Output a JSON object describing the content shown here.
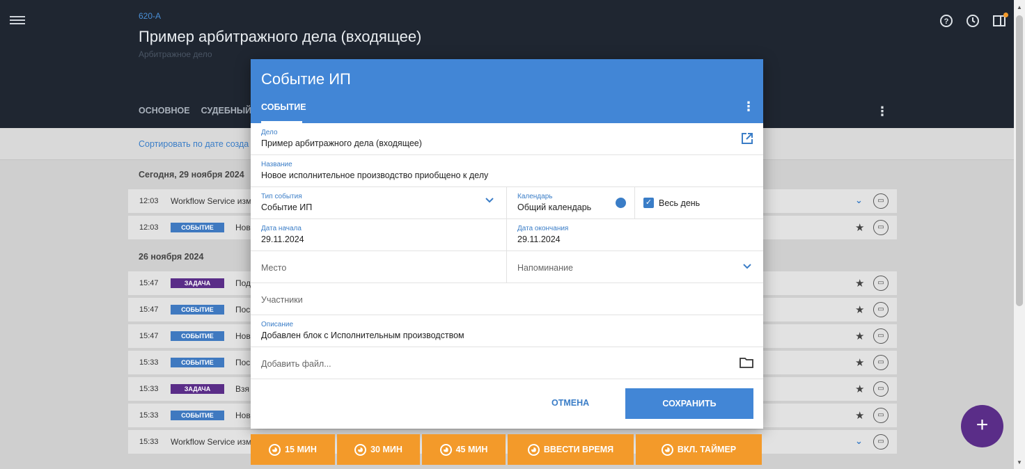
{
  "header": {
    "case_number": "620-А",
    "case_title": "Пример арбитражного дела (входящее)",
    "case_type": "Арбитражное дело",
    "tabs": [
      "ОСНОВНОЕ",
      "СУДЕБНЫЙ П"
    ]
  },
  "sort": {
    "label": "Сортировать по дате созда"
  },
  "list": {
    "groups": [
      {
        "date": "Сегодня, 29 ноября 2024",
        "rows": [
          {
            "time": "12:03",
            "badge": "",
            "text": "Workflow Service изм"
          },
          {
            "time": "12:03",
            "badge": "СОБЫТИЕ",
            "text": "Нов"
          }
        ]
      },
      {
        "date": "26 ноября 2024",
        "rows": [
          {
            "time": "15:47",
            "badge": "ЗАДАЧА",
            "text": "Под"
          },
          {
            "time": "15:47",
            "badge": "СОБЫТИЕ",
            "text": "Пос"
          },
          {
            "time": "15:47",
            "badge": "СОБЫТИЕ",
            "text": "Нов"
          },
          {
            "time": "15:33",
            "badge": "СОБЫТИЕ",
            "text": "Пос"
          },
          {
            "time": "15:33",
            "badge": "ЗАДАЧА",
            "text": "Взя"
          },
          {
            "time": "15:33",
            "badge": "СОБЫТИЕ",
            "text": "Нов"
          },
          {
            "time": "15:33",
            "badge": "",
            "text": "Workflow Service изм"
          }
        ]
      }
    ]
  },
  "dialog": {
    "title": "Событие ИП",
    "tab": "СОБЫТИЕ",
    "case_label": "Дело",
    "case_value": "Пример арбитражного дела (входящее)",
    "name_label": "Название",
    "name_value": "Новое исполнительное производство приобщено к делу",
    "event_type_label": "Тип события",
    "event_type_value": "Событие ИП",
    "calendar_label": "Календарь",
    "calendar_value": "Общий календарь",
    "calendar_color": "#3a7dc7",
    "all_day_label": "Весь день",
    "start_label": "Дата начала",
    "start_value": "29.11.2024",
    "end_label": "Дата окончания",
    "end_value": "29.11.2024",
    "place_placeholder": "Место",
    "reminder_placeholder": "Напоминание",
    "participants_placeholder": "Участники",
    "description_label": "Описание",
    "description_value": "Добавлен блок с Исполнительным производством",
    "file_placeholder": "Добавить файл...",
    "cancel_label": "ОТМЕНА",
    "save_label": "СОХРАНИТЬ"
  },
  "timers": [
    "15 МИН",
    "30 МИН",
    "45 МИН",
    "ВВЕСТИ ВРЕМЯ",
    "ВКЛ. ТАЙМЕР"
  ],
  "colors": {
    "header_bg": "#1f2631",
    "accent": "#4286d6",
    "event_badge": "#3f79c0",
    "task_badge": "#5a2d88",
    "timer": "#f39a2a"
  },
  "icons": [
    "menu-icon",
    "help-icon",
    "clock-icon",
    "panel-icon",
    "kebab-icon",
    "open-external-icon",
    "chevron-down-icon",
    "checkbox-checked-icon",
    "folder-icon",
    "star-icon",
    "comment-icon",
    "add-icon",
    "timer-icon"
  ]
}
